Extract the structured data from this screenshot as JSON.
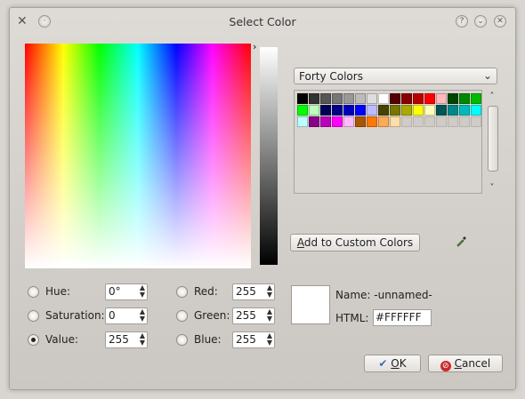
{
  "window": {
    "title": "Select Color",
    "help_glyph": "?",
    "min_glyph": "⌄",
    "close_glyph": "✕",
    "app_icon": "tools-icon",
    "pin_glyph": "·"
  },
  "colors_panel": {
    "selector_glyph": "›",
    "palette_dropdown": "Forty Colors",
    "dropdown_chevron": "⌄",
    "swatches": [
      "#000000",
      "#333333",
      "#555555",
      "#777777",
      "#999999",
      "#bbbbbb",
      "#dddddd",
      "#ffffff",
      "#550000",
      "#880000",
      "#bb0000",
      "#ff0000",
      "#ffbbbb",
      "#004400",
      "#008800",
      "#00bb00",
      "#00ff00",
      "#bbffbb",
      "#000055",
      "#000088",
      "#0000bb",
      "#0000ff",
      "#bbbbff",
      "#444400",
      "#777700",
      "#aaaa00",
      "#ffff00",
      "#ffffbb",
      "#005555",
      "#008888",
      "#00bbbb",
      "#00ffff",
      "#bbffff",
      "#880088",
      "#bb00bb",
      "#ff00ff",
      "#ffbbff",
      "#aa5500",
      "#ff7700",
      "#ffaa55",
      "#ffddaa",
      "",
      "",
      "",
      "",
      "",
      "",
      ""
    ],
    "scroll_up": "˄",
    "scroll_down": "˅",
    "add_custom_label": "Add to Custom Colors",
    "add_custom_mnemonic": "A",
    "add_custom_rest": "dd to Custom Colors",
    "picker_icon": "eyedropper-icon"
  },
  "fields": {
    "hue_label": "Hue:",
    "hue_value": "0°",
    "saturation_label": "Saturation:",
    "saturation_value": "0",
    "value_label": "Value:",
    "value_value": "255",
    "red_label": "Red:",
    "red_value": "255",
    "green_label": "Green:",
    "green_value": "255",
    "blue_label": "Blue:",
    "blue_value": "255",
    "spin_up": "▲",
    "spin_down": "▼"
  },
  "preview": {
    "color": "#FFFFFF",
    "name_label": "Name: -unnamed-",
    "html_label": "HTML:",
    "html_value": "#FFFFFF"
  },
  "buttons": {
    "ok_mnemonic": "O",
    "ok_rest": "K",
    "ok_icon": "✔",
    "cancel_mnemonic": "C",
    "cancel_rest": "ancel",
    "cancel_icon": "⊘"
  }
}
